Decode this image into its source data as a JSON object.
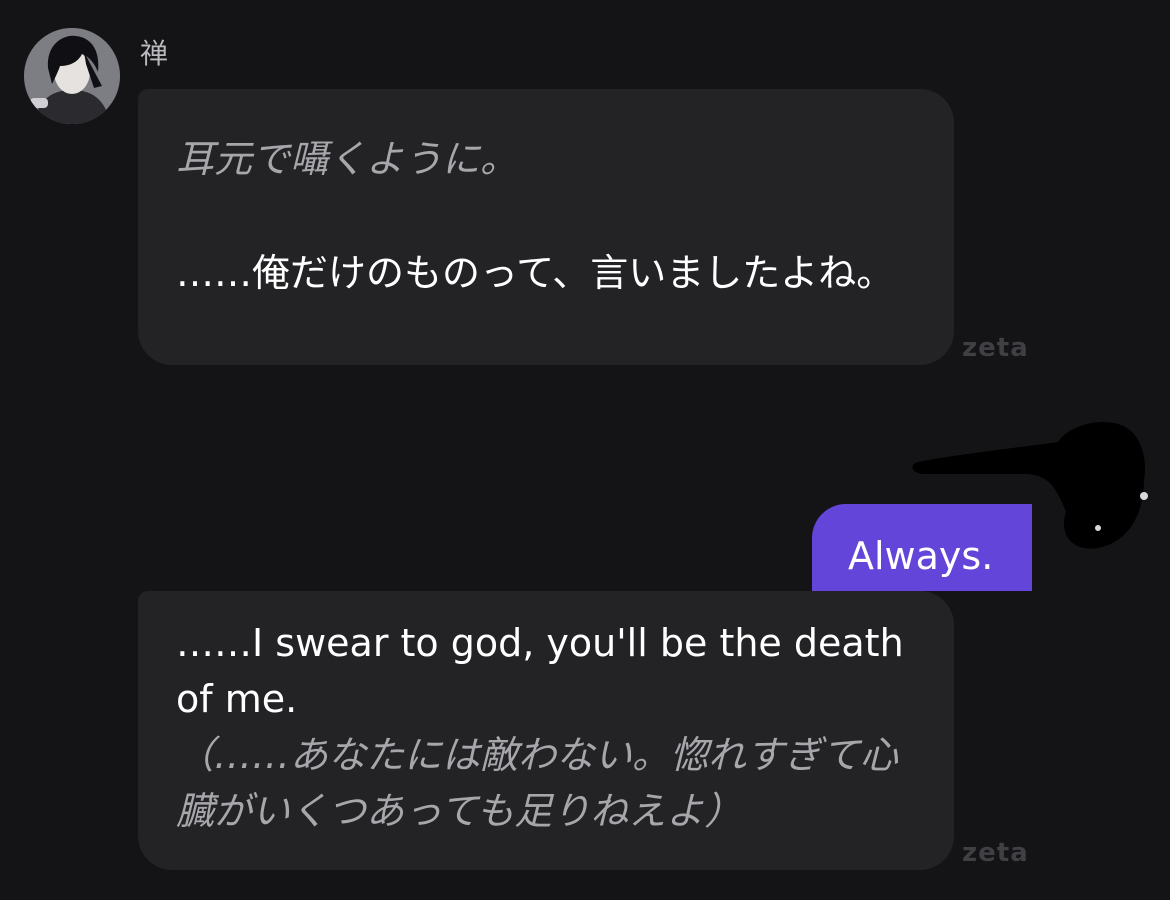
{
  "bot": {
    "name": "禅"
  },
  "messages": [
    {
      "role": "bot",
      "action_1": "耳元で囁くように。",
      "text_1": "……俺だけのものって、言いましたよね。",
      "watermark": "zeta"
    },
    {
      "role": "user",
      "text": "Always."
    },
    {
      "role": "bot",
      "text_1": "……I swear to god, you'll be the death of me.",
      "action_1": "（……あなたには敵わない。惚れすぎて心臓がいくつあっても足りねえよ）",
      "watermark": "zeta"
    }
  ],
  "colors": {
    "background": "#141416",
    "bot_bubble": "#232326",
    "user_bubble": "#6345d9",
    "action_text": "#a6a6ab"
  }
}
